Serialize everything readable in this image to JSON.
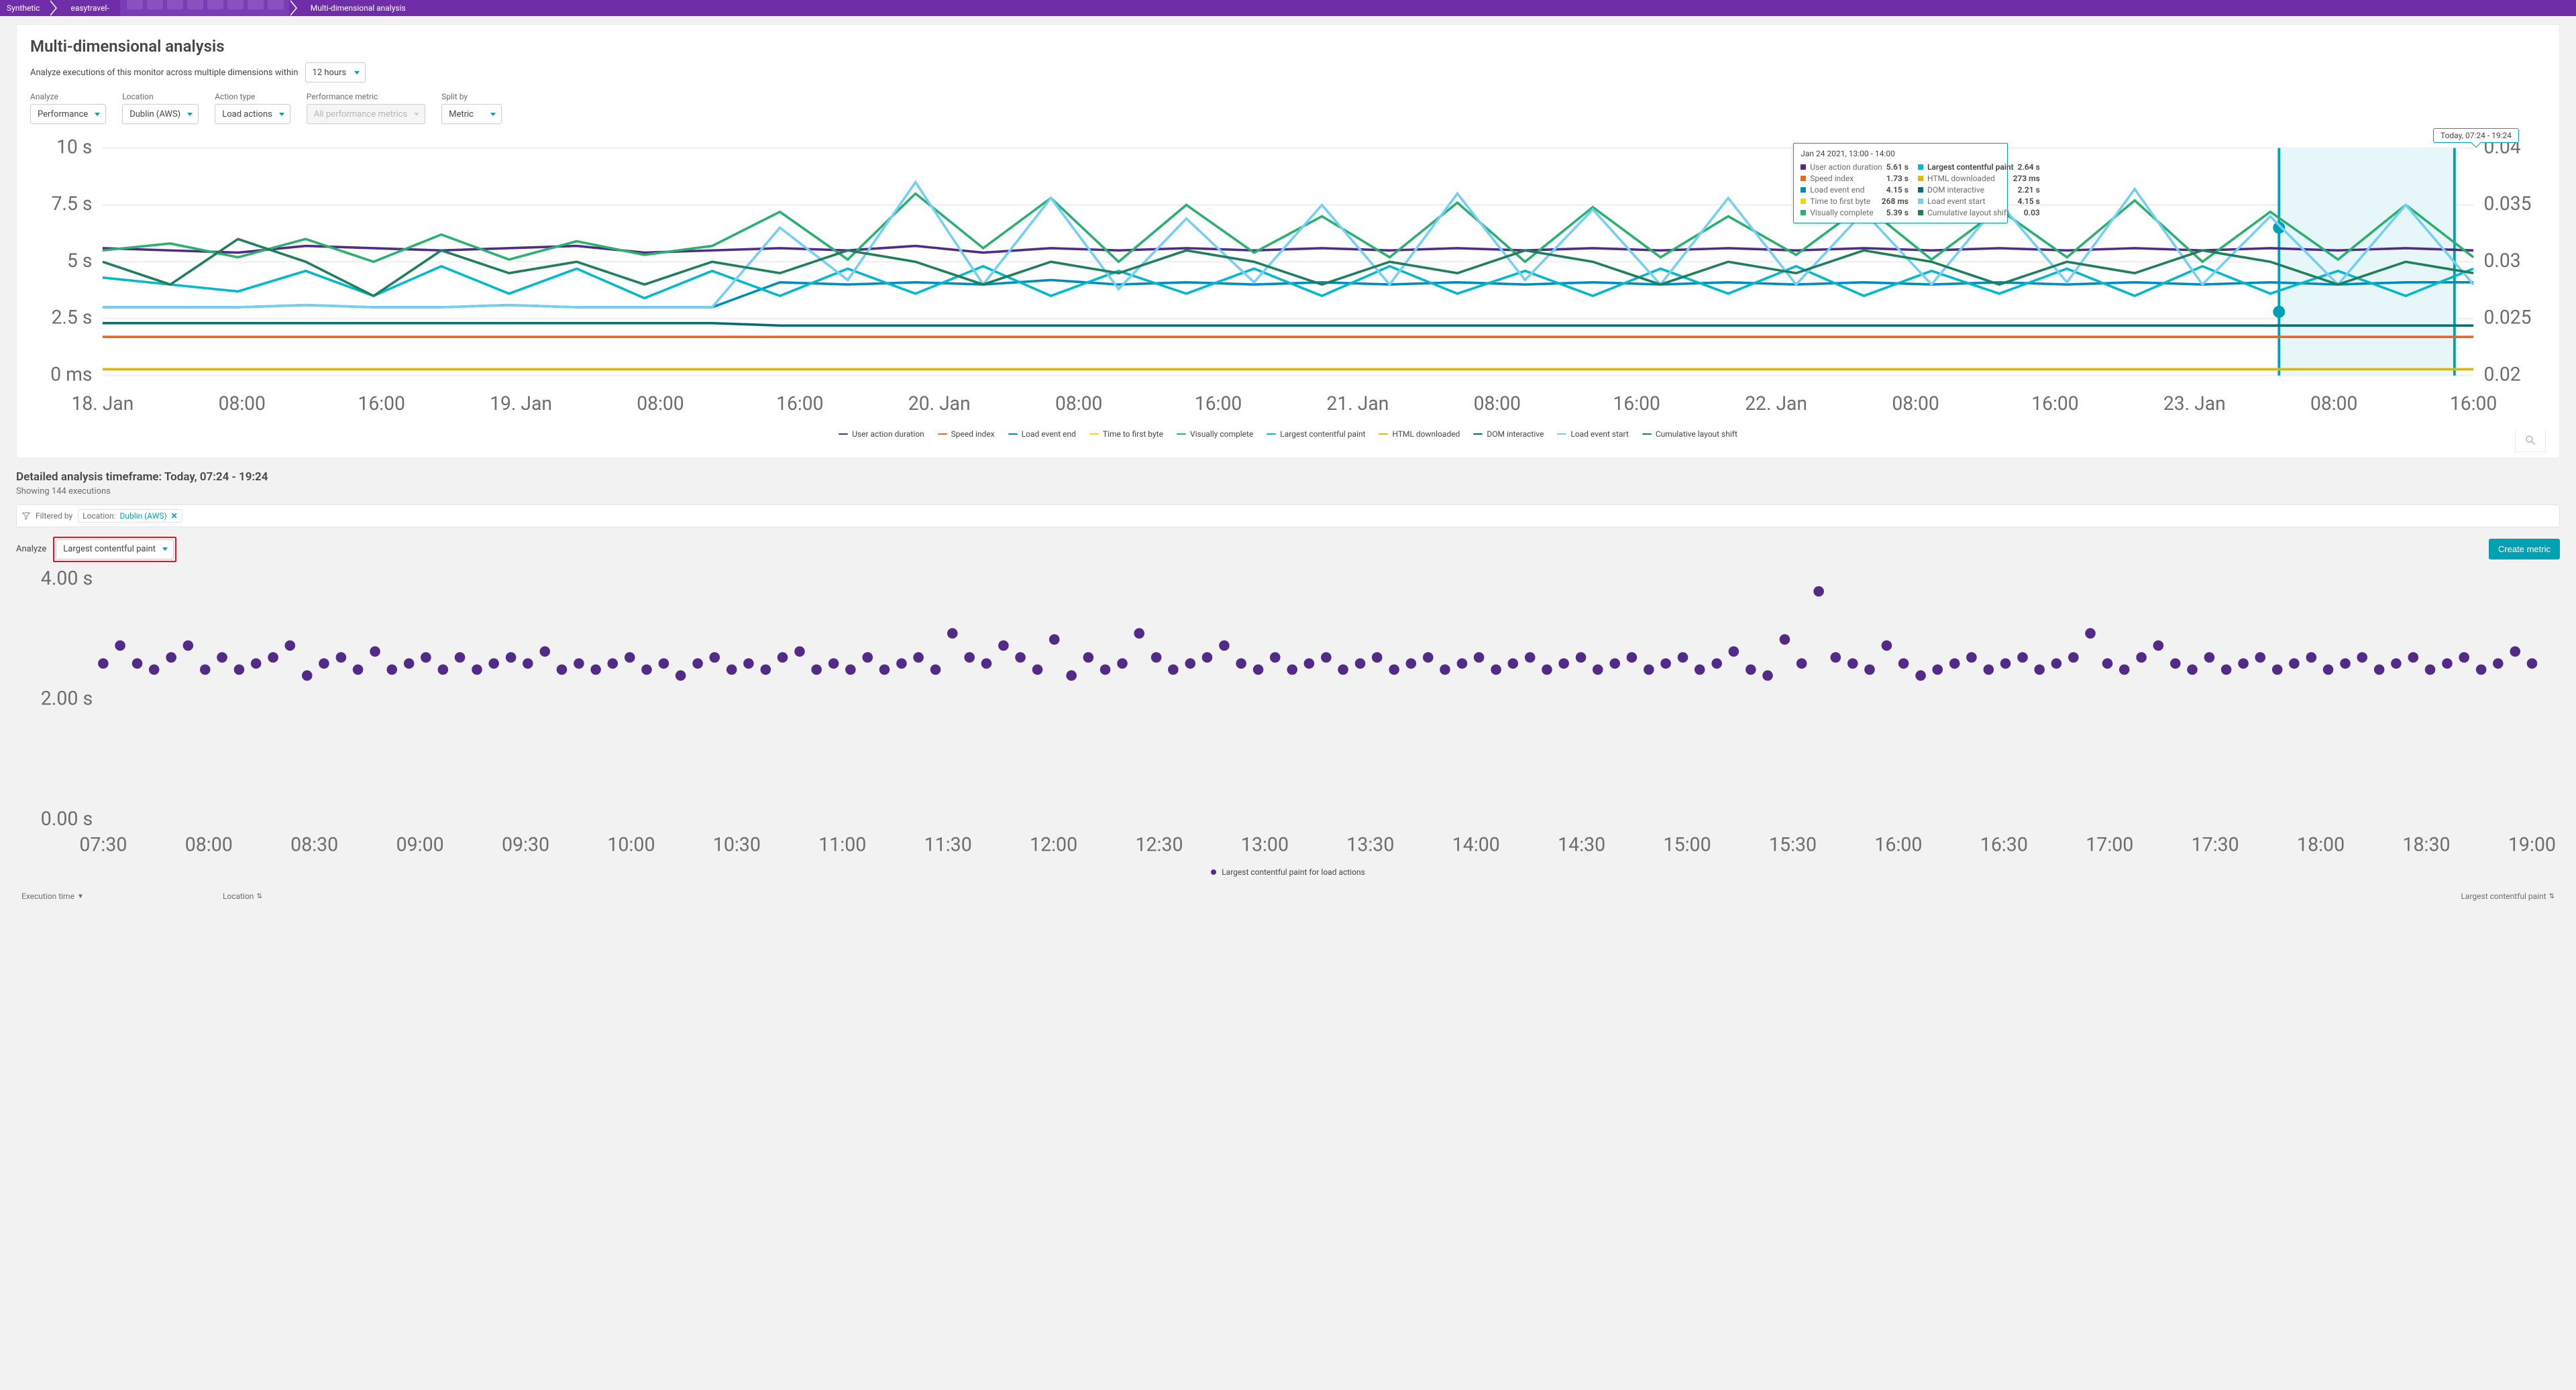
{
  "breadcrumb": {
    "root": "Synthetic",
    "mid": "easytravel-",
    "current": "Multi-dimensional analysis"
  },
  "header": {
    "title": "Multi-dimensional analysis",
    "subtitle": "Analyze executions of this monitor across multiple dimensions within",
    "timeframe_dd": "12 hours"
  },
  "filters": {
    "analyze": {
      "label": "Analyze",
      "value": "Performance"
    },
    "location": {
      "label": "Location",
      "value": "Dublin (AWS)"
    },
    "action": {
      "label": "Action type",
      "value": "Load actions"
    },
    "metric": {
      "label": "Performance metric",
      "placeholder": "All performance metrics"
    },
    "split": {
      "label": "Split by",
      "value": "Metric"
    }
  },
  "time_range_badge": "Today, 07:24 - 19:24",
  "chart_data": {
    "type": "line",
    "xlabel": "",
    "ylabel_left": "",
    "ylabel_right": "",
    "x_ticks": [
      "18. Jan",
      "08:00",
      "16:00",
      "19. Jan",
      "08:00",
      "16:00",
      "20. Jan",
      "08:00",
      "16:00",
      "21. Jan",
      "08:00",
      "16:00",
      "22. Jan",
      "08:00",
      "16:00",
      "23. Jan",
      "08:00",
      "16:00"
    ],
    "y_left_ticks": [
      "0 ms",
      "2.5 s",
      "5 s",
      "7.5 s",
      "10 s"
    ],
    "y_right_ticks": [
      "0.02",
      "0.025",
      "0.03",
      "0.035",
      "0.04"
    ],
    "series": [
      {
        "name": "User action duration",
        "color": "#522b89",
        "values": [
          5.6,
          5.5,
          5.4,
          5.7,
          5.6,
          5.5,
          5.6,
          5.7,
          5.4,
          5.5,
          5.6,
          5.5,
          5.7,
          5.4,
          5.6,
          5.5,
          5.6,
          5.5,
          5.6,
          5.5,
          5.6,
          5.5,
          5.6,
          5.5,
          5.6,
          5.5,
          5.6,
          5.5,
          5.6,
          5.5,
          5.6,
          5.5,
          5.6,
          5.5,
          5.6,
          5.5
        ]
      },
      {
        "name": "Speed index",
        "color": "#ef651f",
        "values": [
          1.7,
          1.7,
          1.7,
          1.7,
          1.7,
          1.7,
          1.7,
          1.7,
          1.7,
          1.7,
          1.7,
          1.7,
          1.7,
          1.7,
          1.7,
          1.7,
          1.7,
          1.7,
          1.7,
          1.7,
          1.7,
          1.7,
          1.7,
          1.7,
          1.7,
          1.7,
          1.7,
          1.7,
          1.7,
          1.7,
          1.7,
          1.7,
          1.7,
          1.7,
          1.7,
          1.7
        ]
      },
      {
        "name": "Load event end",
        "color": "#008cba",
        "values": [
          3.0,
          3.0,
          3.0,
          3.1,
          3.0,
          3.0,
          3.1,
          3.0,
          3.0,
          3.0,
          4.1,
          4.0,
          4.1,
          4.0,
          4.2,
          4.0,
          4.1,
          4.0,
          4.1,
          4.0,
          4.1,
          4.0,
          4.1,
          4.0,
          4.1,
          4.0,
          4.1,
          4.0,
          4.1,
          4.0,
          4.1,
          4.0,
          4.1,
          4.0,
          4.1,
          4.1
        ]
      },
      {
        "name": "Time to first byte",
        "color": "#f5d30f",
        "values": [
          0.27,
          0.27,
          0.27,
          0.27,
          0.27,
          0.27,
          0.27,
          0.27,
          0.27,
          0.27,
          0.27,
          0.27,
          0.27,
          0.27,
          0.27,
          0.27,
          0.27,
          0.27,
          0.27,
          0.27,
          0.27,
          0.27,
          0.27,
          0.27,
          0.27,
          0.27,
          0.27,
          0.27,
          0.27,
          0.27,
          0.27,
          0.27,
          0.27,
          0.27,
          0.27,
          0.27
        ]
      },
      {
        "name": "Visually complete",
        "color": "#2ab06f",
        "values": [
          5.5,
          5.8,
          5.2,
          6.0,
          5.0,
          6.2,
          5.1,
          5.9,
          5.3,
          5.7,
          7.2,
          5.1,
          8.0,
          5.6,
          7.8,
          5.0,
          7.5,
          5.4,
          7.0,
          5.2,
          7.6,
          5.0,
          7.4,
          5.2,
          7.0,
          5.3,
          7.5,
          5.1,
          7.3,
          5.2,
          7.7,
          5.0,
          7.2,
          5.1,
          7.5,
          5.2
        ]
      },
      {
        "name": "Largest contentful paint",
        "color": "#00b9cc",
        "values": [
          4.3,
          4.0,
          3.7,
          4.6,
          3.5,
          4.8,
          3.6,
          4.7,
          3.4,
          4.6,
          3.5,
          4.7,
          3.6,
          4.8,
          3.5,
          4.6,
          3.6,
          4.7,
          3.5,
          4.8,
          3.6,
          4.6,
          3.5,
          4.7,
          3.6,
          4.8,
          3.5,
          4.6,
          3.6,
          4.7,
          3.5,
          4.8,
          3.6,
          4.6,
          3.5,
          4.7
        ]
      },
      {
        "name": "HTML downloaded",
        "color": "#debb00",
        "values": [
          0.27,
          0.27,
          0.27,
          0.27,
          0.27,
          0.27,
          0.27,
          0.27,
          0.27,
          0.27,
          0.27,
          0.27,
          0.27,
          0.27,
          0.27,
          0.27,
          0.27,
          0.27,
          0.27,
          0.27,
          0.27,
          0.27,
          0.27,
          0.27,
          0.27,
          0.27,
          0.27,
          0.27,
          0.27,
          0.27,
          0.27,
          0.27,
          0.27,
          0.27,
          0.27,
          0.27
        ]
      },
      {
        "name": "DOM interactive",
        "color": "#006d75",
        "values": [
          2.3,
          2.3,
          2.3,
          2.3,
          2.3,
          2.3,
          2.3,
          2.3,
          2.3,
          2.3,
          2.2,
          2.2,
          2.2,
          2.2,
          2.2,
          2.2,
          2.2,
          2.2,
          2.2,
          2.2,
          2.2,
          2.2,
          2.2,
          2.2,
          2.2,
          2.2,
          2.2,
          2.2,
          2.2,
          2.2,
          2.2,
          2.2,
          2.2,
          2.2,
          2.2,
          2.2
        ]
      },
      {
        "name": "Load event start",
        "color": "#74cff7",
        "values": [
          3.0,
          3.0,
          3.0,
          3.1,
          3.0,
          3.0,
          3.1,
          3.0,
          3.0,
          3.0,
          6.5,
          4.2,
          8.5,
          4.0,
          7.8,
          3.8,
          6.9,
          4.1,
          7.5,
          4.0,
          8.0,
          4.2,
          7.3,
          4.0,
          7.8,
          4.0,
          7.2,
          4.0,
          7.6,
          4.1,
          8.2,
          4.0,
          7.0,
          4.0,
          7.5,
          4.0
        ]
      },
      {
        "name": "Cumulative layout shift",
        "color": "#1f7e5c",
        "values": [
          0.03,
          0.028,
          0.032,
          0.03,
          0.027,
          0.031,
          0.029,
          0.03,
          0.028,
          0.03,
          0.029,
          0.031,
          0.03,
          0.028,
          0.03,
          0.029,
          0.031,
          0.03,
          0.028,
          0.03,
          0.029,
          0.031,
          0.03,
          0.028,
          0.03,
          0.029,
          0.031,
          0.03,
          0.028,
          0.03,
          0.029,
          0.031,
          0.03,
          0.028,
          0.03,
          0.029
        ]
      }
    ],
    "ylim_left": [
      0,
      10
    ],
    "ylim_right": [
      0.02,
      0.04
    ],
    "highlight_window": {
      "from_frac": 0.918,
      "to_frac": 0.992
    },
    "vline_frac": 0.712
  },
  "tooltip": {
    "title": "Jan 24 2021, 13:00 - 14:00",
    "pos_frac": 0.712,
    "left_col": [
      {
        "name": "User action duration",
        "value": "5.61 s",
        "color": "#522b89"
      },
      {
        "name": "Speed index",
        "value": "1.73 s",
        "color": "#ef651f"
      },
      {
        "name": "Load event end",
        "value": "4.15 s",
        "color": "#008cba"
      },
      {
        "name": "Time to first byte",
        "value": "268 ms",
        "color": "#f5d30f"
      },
      {
        "name": "Visually complete",
        "value": "5.39 s",
        "color": "#2ab06f"
      }
    ],
    "right_col": [
      {
        "name": "Largest contentful paint",
        "value": "2.64 s",
        "color": "#00b9cc",
        "bold": true
      },
      {
        "name": "HTML downloaded",
        "value": "273 ms",
        "color": "#debb00"
      },
      {
        "name": "DOM interactive",
        "value": "2.21 s",
        "color": "#006d75"
      },
      {
        "name": "Load event start",
        "value": "4.15 s",
        "color": "#74cff7"
      },
      {
        "name": "Cumulative layout shift",
        "value": "0.03",
        "color": "#1f7e5c"
      }
    ]
  },
  "detailed": {
    "title": "Detailed analysis timeframe: Today, 07:24 - 19:24",
    "subtitle": "Showing 144 executions",
    "filter_label": "Filtered by",
    "chip_prefix": "Location:",
    "chip_value": "Dublin (AWS)",
    "analyze_label": "Analyze",
    "analyze_value": "Largest contentful paint",
    "create_btn": "Create metric"
  },
  "scatter": {
    "type": "scatter",
    "y_ticks": [
      "0.00 s",
      "2.00 s",
      "4.00 s"
    ],
    "x_ticks": [
      "07:30",
      "08:00",
      "08:30",
      "09:00",
      "09:30",
      "10:00",
      "10:30",
      "11:00",
      "11:30",
      "12:00",
      "12:30",
      "13:00",
      "13:30",
      "14:00",
      "14:30",
      "15:00",
      "15:30",
      "16:00",
      "16:30",
      "17:00",
      "17:30",
      "18:00",
      "18:30",
      "19:00"
    ],
    "ylim": [
      0,
      4
    ],
    "legend": "Largest contentful paint for load actions",
    "color": "#522b89",
    "values": [
      2.6,
      2.9,
      2.6,
      2.5,
      2.7,
      2.9,
      2.5,
      2.7,
      2.5,
      2.6,
      2.7,
      2.9,
      2.4,
      2.6,
      2.7,
      2.5,
      2.8,
      2.5,
      2.6,
      2.7,
      2.5,
      2.7,
      2.5,
      2.6,
      2.7,
      2.6,
      2.8,
      2.5,
      2.6,
      2.5,
      2.6,
      2.7,
      2.5,
      2.6,
      2.4,
      2.6,
      2.7,
      2.5,
      2.6,
      2.5,
      2.7,
      2.8,
      2.5,
      2.6,
      2.5,
      2.7,
      2.5,
      2.6,
      2.7,
      2.5,
      3.1,
      2.7,
      2.6,
      2.9,
      2.7,
      2.5,
      3.0,
      2.4,
      2.7,
      2.5,
      2.6,
      3.1,
      2.7,
      2.5,
      2.6,
      2.7,
      2.9,
      2.6,
      2.5,
      2.7,
      2.5,
      2.6,
      2.7,
      2.5,
      2.6,
      2.7,
      2.5,
      2.6,
      2.7,
      2.5,
      2.6,
      2.7,
      2.5,
      2.6,
      2.7,
      2.5,
      2.6,
      2.7,
      2.5,
      2.6,
      2.7,
      2.5,
      2.6,
      2.7,
      2.5,
      2.6,
      2.8,
      2.5,
      2.4,
      3.0,
      2.6,
      3.8,
      2.7,
      2.6,
      2.5,
      2.9,
      2.6,
      2.4,
      2.5,
      2.6,
      2.7,
      2.5,
      2.6,
      2.7,
      2.5,
      2.6,
      2.7,
      3.1,
      2.6,
      2.5,
      2.7,
      2.9,
      2.6,
      2.5,
      2.7,
      2.5,
      2.6,
      2.7,
      2.5,
      2.6,
      2.7,
      2.5,
      2.6,
      2.7,
      2.5,
      2.6,
      2.7,
      2.5,
      2.6,
      2.7,
      2.5,
      2.6,
      2.8,
      2.6
    ]
  },
  "table": {
    "col_exec": "Execution time",
    "col_loc": "Location",
    "col_lcp": "Largest contentful paint"
  }
}
